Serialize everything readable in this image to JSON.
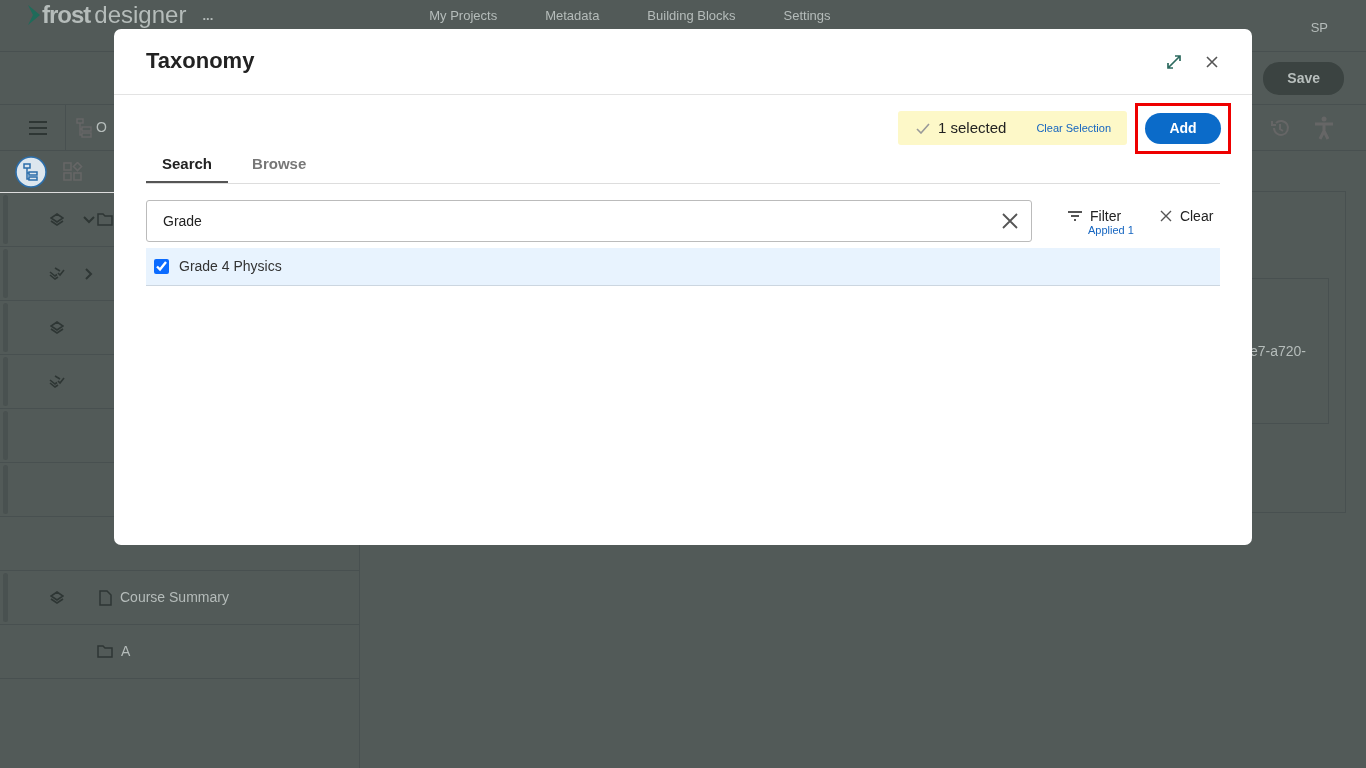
{
  "app": {
    "logo": {
      "brand": "frost",
      "product": "designer"
    },
    "more_menu": "...",
    "nav": [
      "My Projects",
      "Metadata",
      "Building Blocks",
      "Settings"
    ],
    "user": "SP",
    "save_button": "Save",
    "toolbar_label": "O",
    "sidebar_rows": [
      {
        "kind": "layers-folder",
        "expanded": true
      },
      {
        "kind": "layers-check",
        "expanded": false
      },
      {
        "kind": "layers"
      },
      {
        "kind": "layers-check"
      },
      {
        "kind": "handle"
      },
      {
        "kind": "handle"
      },
      {
        "kind": "plain"
      },
      {
        "kind": "layers-page",
        "label": "Course Summary"
      },
      {
        "kind": "folder",
        "label": "A"
      }
    ],
    "detail_text": "e7-a720-"
  },
  "dialog": {
    "title": "Taxonomy",
    "selected_count": "1 selected",
    "clear_selection": "Clear Selection",
    "add_button": {
      "label": "Add",
      "highlighted": true
    },
    "tabs": [
      {
        "label": "Search",
        "selected": true
      },
      {
        "label": "Browse",
        "selected": false
      }
    ],
    "search": {
      "value": "Grade"
    },
    "filter": {
      "label": "Filter",
      "note": "Applied 1"
    },
    "clear": "Clear",
    "results": [
      {
        "label": "Grade 4 Physics",
        "checked": true
      }
    ]
  }
}
